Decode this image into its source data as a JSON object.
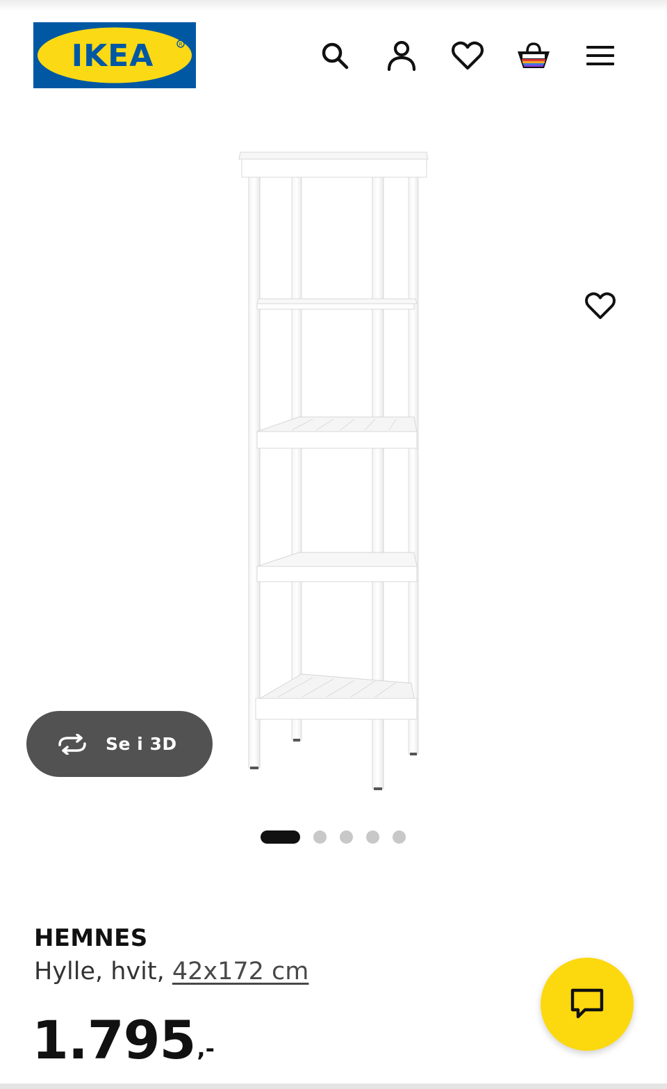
{
  "header": {
    "logo_text": "IKEA",
    "icons": [
      "search-icon",
      "profile-icon",
      "heart-icon",
      "shopping-basket-icon",
      "menu-icon"
    ]
  },
  "gallery": {
    "view3d_label": "Se i 3D",
    "view3d_icon": "rotate-3d-icon",
    "favorite_icon": "heart-icon",
    "image_count": 5,
    "active_index": 0
  },
  "product": {
    "name": "HEMNES",
    "description": "Hylle, hvit,",
    "size_link": "42x172 cm",
    "price_amount": "1.795",
    "price_suffix": ",-"
  },
  "chat": {
    "icon": "chat-icon"
  },
  "colors": {
    "ikea_blue": "#0058a3",
    "ikea_yellow": "#fbd914",
    "chat_yellow": "#fcd80f",
    "button_dark": "#525252",
    "text": "#111111"
  }
}
